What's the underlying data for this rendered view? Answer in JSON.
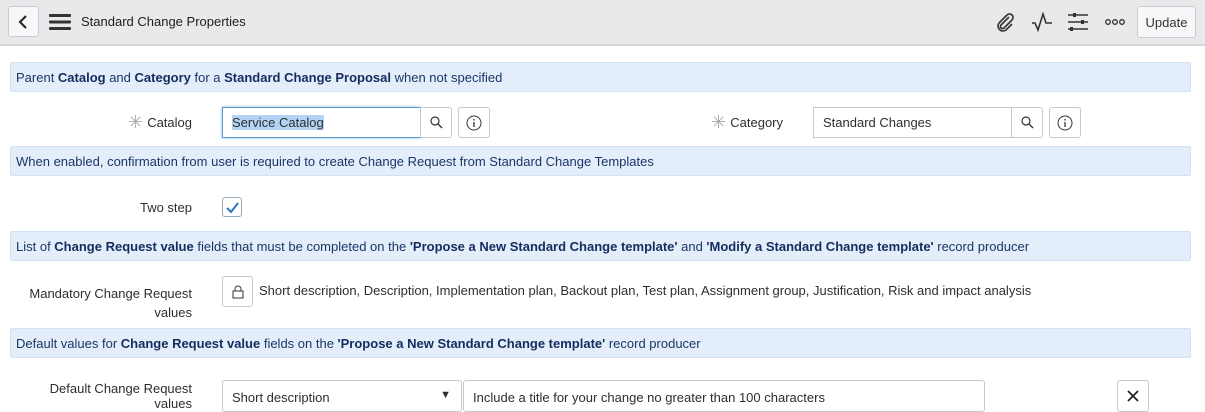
{
  "header": {
    "title": "Standard Change Properties",
    "update_label": "Update"
  },
  "section1": {
    "t1": "Parent ",
    "b1": "Catalog",
    "t2": " and ",
    "b2": "Category",
    "t3": " for a ",
    "b3": "Standard Change Proposal",
    "t4": " when not specified"
  },
  "catalog": {
    "label": "Catalog",
    "value": "Service Catalog"
  },
  "category": {
    "label": "Category",
    "value": "Standard Changes"
  },
  "section2": {
    "text": "When enabled, confirmation from user is required to create Change Request from Standard Change Templates"
  },
  "two_step": {
    "label": "Two step",
    "checked": true
  },
  "section3": {
    "t1": "List of ",
    "b1": "Change Request value",
    "t2": " fields that must be completed on the ",
    "b2": "'Propose a New Standard Change template'",
    "t3": " and ",
    "b3": "'Modify a Standard Change template'",
    "t4": " record producer"
  },
  "mandatory": {
    "label": "Mandatory Change Request values",
    "value": "Short description, Description, Implementation plan, Backout plan, Test plan, Assignment group, Justification, Risk and impact analysis"
  },
  "section4": {
    "t1": "Default values for ",
    "b1": "Change Request value",
    "t2": " fields on the ",
    "b2": "'Propose a New Standard Change template'",
    "t3": " record producer"
  },
  "defaults": {
    "label": "Default Change Request values",
    "field": "Short description",
    "value": "Include a title for your change no greater than 100 characters"
  }
}
